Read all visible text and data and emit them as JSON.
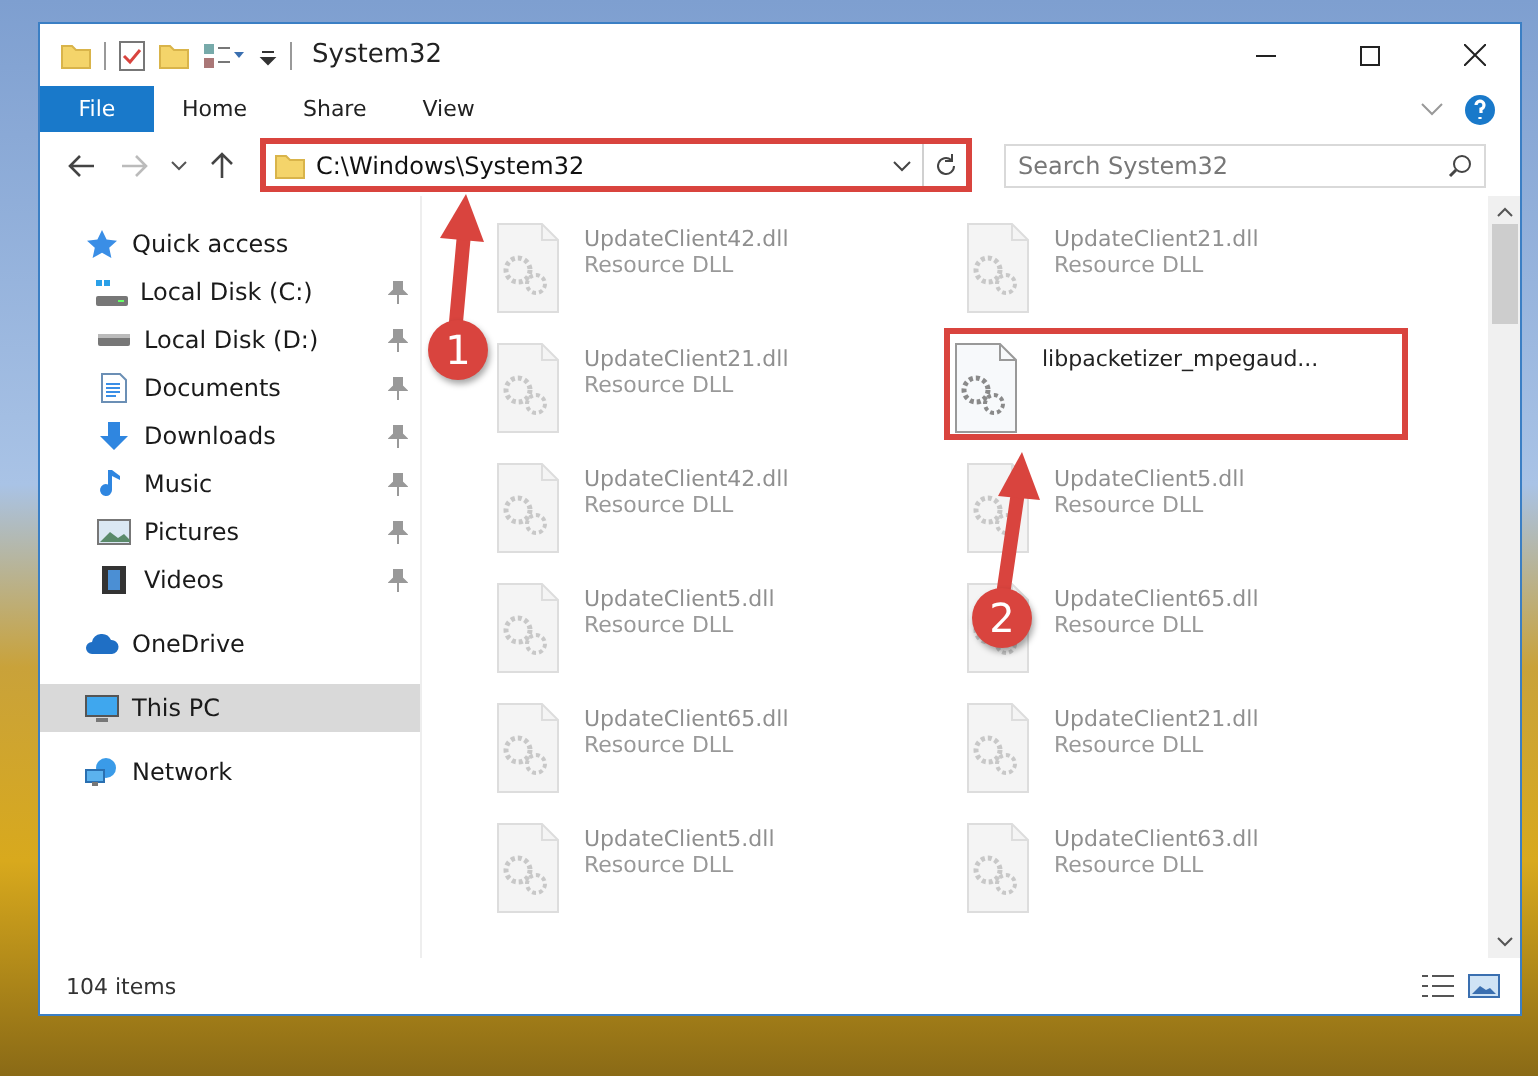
{
  "window": {
    "title": "System32"
  },
  "ribbon_tabs": [
    {
      "label": "File",
      "selected": true
    },
    {
      "label": "Home",
      "selected": false
    },
    {
      "label": "Share",
      "selected": false
    },
    {
      "label": "View",
      "selected": false
    }
  ],
  "address": {
    "value": "C:\\Windows\\System32",
    "highlighted": true
  },
  "search": {
    "placeholder": "Search System32"
  },
  "sidebar": {
    "items": [
      {
        "label": "Quick access",
        "kind": "star",
        "selected": false,
        "children": [
          {
            "label": "Local Disk (C:)",
            "kind": "system-drive",
            "selected": false,
            "pinned": true
          },
          {
            "label": "Local Disk (D:)",
            "kind": "drive",
            "selected": false,
            "pinned": true
          },
          {
            "label": "Documents",
            "kind": "documents",
            "selected": false,
            "pinned": true
          },
          {
            "label": "Downloads",
            "kind": "downloads",
            "selected": false,
            "pinned": true
          },
          {
            "label": "Music",
            "kind": "music",
            "selected": false,
            "pinned": true
          },
          {
            "label": "Pictures",
            "kind": "pictures",
            "selected": false,
            "pinned": true
          },
          {
            "label": "Videos",
            "kind": "videos",
            "selected": false,
            "pinned": true
          }
        ]
      },
      {
        "label": "OneDrive",
        "kind": "cloud",
        "selected": false
      },
      {
        "label": "This PC",
        "kind": "pc",
        "selected": true
      },
      {
        "label": "Network",
        "kind": "network",
        "selected": false
      }
    ]
  },
  "files": [
    {
      "name": "UpdateClient42.dll",
      "type": "Resource DLL",
      "faded": true,
      "highlighted": false
    },
    {
      "name": "UpdateClient21.dll",
      "type": "Resource DLL",
      "faded": true,
      "highlighted": false
    },
    {
      "name": "UpdateClient21.dll",
      "type": "Resource DLL",
      "faded": true,
      "highlighted": false
    },
    {
      "name": "libpacketizer_mpegaud...",
      "faded": false,
      "highlighted": true
    },
    {
      "name": "UpdateClient42.dll",
      "type": "Resource DLL",
      "faded": true,
      "highlighted": false
    },
    {
      "name": "UpdateClient5.dll",
      "type": "Resource DLL",
      "faded": true,
      "highlighted": false
    },
    {
      "name": "UpdateClient5.dll",
      "type": "Resource DLL",
      "faded": true,
      "highlighted": false
    },
    {
      "name": "UpdateClient65.dll",
      "type": "Resource DLL",
      "faded": true,
      "highlighted": false
    },
    {
      "name": "UpdateClient65.dll",
      "type": "Resource DLL",
      "faded": true,
      "highlighted": false
    },
    {
      "name": "UpdateClient21.dll",
      "type": "Resource DLL",
      "faded": true,
      "highlighted": false
    },
    {
      "name": "UpdateClient5.dll",
      "type": "Resource DLL",
      "faded": true,
      "highlighted": false
    },
    {
      "name": "UpdateClient63.dll",
      "type": "Resource DLL",
      "faded": true,
      "highlighted": false
    }
  ],
  "status_bar": {
    "item_count": "104 items"
  },
  "annotations": [
    {
      "label": "1"
    },
    {
      "label": "2"
    }
  ]
}
